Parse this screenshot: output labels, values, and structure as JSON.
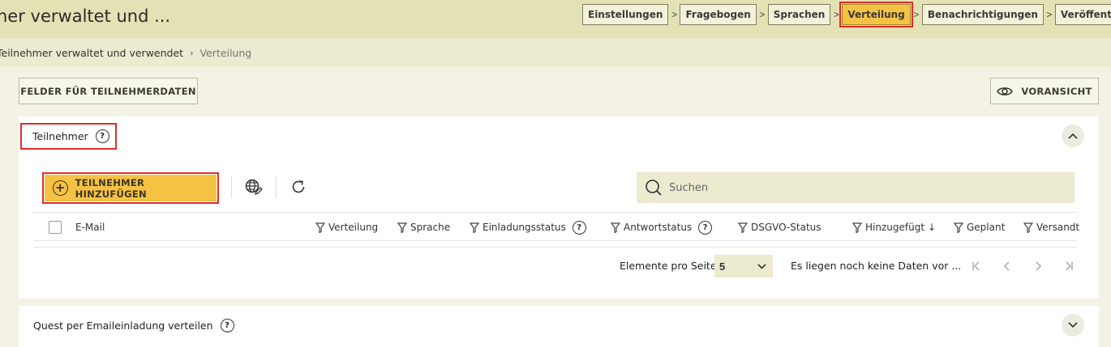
{
  "header": {
    "title": "ner verwaltet und ...",
    "steps": [
      "Einstellungen",
      "Fragebogen",
      "Sprachen",
      "Verteilung",
      "Benachrichtigungen",
      "Veröffentlichen"
    ],
    "active_step": "Verteilung"
  },
  "breadcrumb": {
    "parent": "Teilnehmer verwaltet und verwendet",
    "current": "Verteilung"
  },
  "actions": {
    "fields_button": "FELDER FÜR TEILNEHMERDATEN",
    "preview_button": "VORANSICHT"
  },
  "participants_panel": {
    "title": "Teilnehmer",
    "add_button": "TEILNEHMER HINZUFÜGEN",
    "search_placeholder": "Suchen",
    "columns": {
      "email": "E-Mail",
      "verteilung": "Verteilung",
      "sprache": "Sprache",
      "einladungsstatus": "Einladungsstatus",
      "antwortstatus": "Antwortstatus",
      "dsgvo": "DSGVO-Status",
      "hinzugefuegt": "Hinzugefügt",
      "geplant": "Geplant",
      "versandt": "Versandt"
    },
    "pagination": {
      "label": "Elemente pro Seite",
      "page_size": "5",
      "info": "Es liegen noch keine Daten vor ..."
    }
  },
  "email_panel": {
    "title": "Quest per Emaileinladung verteilen"
  },
  "colors": {
    "accent": "#f6c244",
    "highlight": "#e12b2b",
    "header_bg": "#e4e1b4"
  }
}
